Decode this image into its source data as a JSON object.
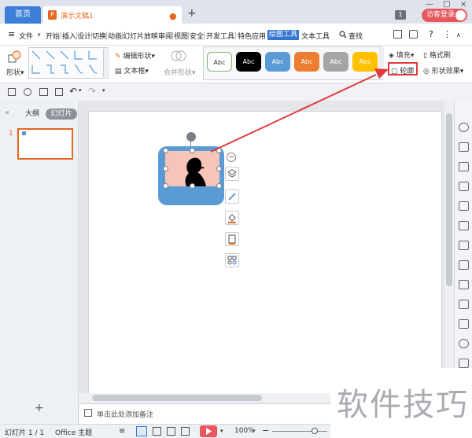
{
  "titlebar": {
    "home_tab": "首页",
    "doc_tab": "演示文稿1",
    "doc_icon_letter": "P",
    "modified_dot": "●",
    "new_tab": "+",
    "page_badge": "1",
    "login": "访客登录",
    "win_min": "—",
    "win_max": "□",
    "win_close": "×"
  },
  "menu": {
    "hamburger": "≡",
    "file": "文件",
    "items": [
      "开始",
      "插入",
      "设计",
      "切换",
      "动画",
      "幻灯片放映",
      "审阅",
      "视图",
      "安全",
      "开发工具",
      "特色应用"
    ],
    "active": "绘图工具",
    "text_tools": "文本工具",
    "search": "查找",
    "help": "?",
    "more": "⋮"
  },
  "ribbon": {
    "shape": "形状",
    "edit_shape": "编辑形状",
    "textbox": "文本框",
    "merge_shape": "合并形状",
    "style_label": "Abc",
    "fill": "填充",
    "format_painter": "格式刷",
    "outline": "轮廓",
    "shape_effect": "形状效果"
  },
  "colors": {
    "accent": "#3476d2",
    "annotation_red": "#e03a3a",
    "shape_blue": "#5b9bd5",
    "shape_pink": "#f7c5b8",
    "swatches": [
      "#ffffff",
      "#000000",
      "#5b9bd5",
      "#ed7d31",
      "#a5a5a5",
      "#ffc000"
    ]
  },
  "leftpanel": {
    "collapse": "«",
    "outline_tab": "大纲",
    "slides_tab": "幻灯片",
    "slide_number": "1",
    "add": "+"
  },
  "notes": {
    "placeholder": "单击此处添加备注"
  },
  "status": {
    "slide_info": "幻灯片 1 / 1",
    "theme": "Office 主题",
    "zoom": "100%",
    "zoom_minus": "−",
    "zoom_plus": "+"
  },
  "watermark": "软件技巧"
}
